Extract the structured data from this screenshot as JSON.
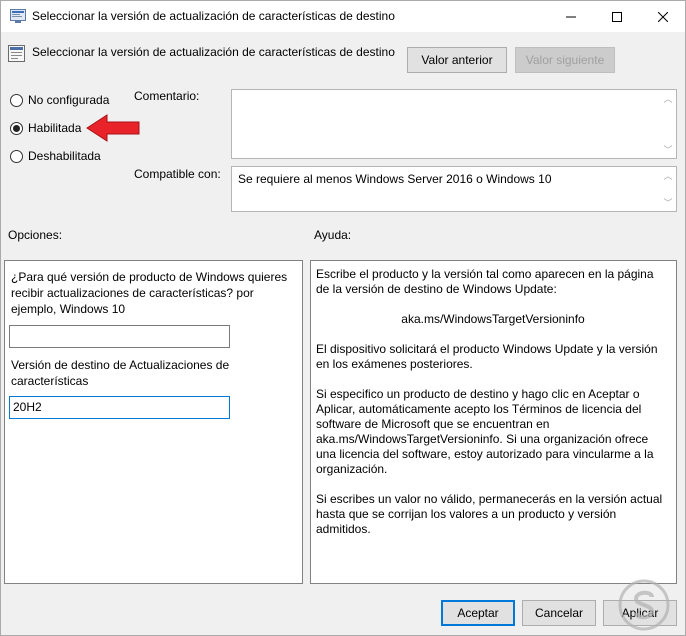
{
  "window": {
    "title": "Seleccionar la versión de actualización de características de destino",
    "controls": {
      "minimize": "minimize",
      "maximize": "maximize",
      "close": "close"
    }
  },
  "header": {
    "title": "Seleccionar la versión de actualización de características de destino",
    "prev_button": "Valor anterior",
    "next_button": "Valor siguiente"
  },
  "radios": [
    {
      "label": "No configurada",
      "checked": false
    },
    {
      "label": "Habilitada",
      "checked": true
    },
    {
      "label": "Deshabilitada",
      "checked": false
    }
  ],
  "comment": {
    "label": "Comentario:",
    "value": ""
  },
  "compatible": {
    "label": "Compatible con:",
    "value": "Se requiere al menos Windows Server 2016 o Windows 10"
  },
  "options": {
    "label": "Opciones:",
    "question": "¿Para qué versión de producto de Windows quieres recibir actualizaciones de características? por ejemplo, Windows 10",
    "product_value": "",
    "target_label": "Versión de destino de Actualizaciones de características",
    "target_value": "20H2"
  },
  "help": {
    "label": "Ayuda:",
    "paragraphs": [
      "Escribe el producto y la versión tal como aparecen en la página de la versión de destino de Windows Update:",
      "aka.ms/WindowsTargetVersioninfo",
      "El dispositivo solicitará el producto Windows Update y la versión en los exámenes posteriores.",
      "Si especifico un producto de destino y hago clic en Aceptar o Aplicar, automáticamente acepto los Términos de licencia del software de Microsoft que se encuentran en aka.ms/WindowsTargetVersioninfo. Si una organización ofrece una licencia del software, estoy autorizado para vincularme a la organización.",
      "Si escribes un valor no válido, permanecerás en la versión actual hasta que se corrijan los valores a un producto y versión admitidos."
    ]
  },
  "footer": {
    "ok": "Aceptar",
    "cancel": "Cancelar",
    "apply": "Aplicar"
  },
  "colors": {
    "accent": "#0078d7",
    "arrow": "#e8232a"
  }
}
